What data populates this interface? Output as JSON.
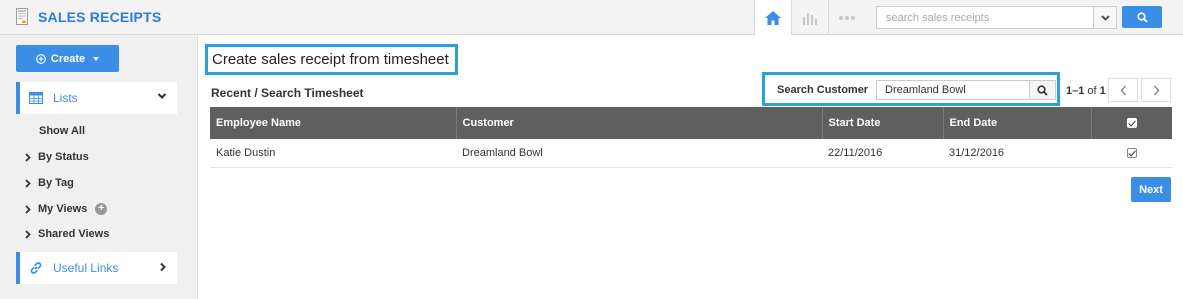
{
  "app": {
    "title": "SALES RECEIPTS",
    "icon": "document-icon"
  },
  "topbar": {
    "nav_icons": [
      "home-icon",
      "bar-chart-icon",
      "more-dots-icon"
    ],
    "search": {
      "placeholder": "search sales receipts",
      "value": ""
    },
    "accent": "#3a8ee6"
  },
  "sidebar": {
    "create_label": "Create",
    "lists_label": "Lists",
    "items": [
      {
        "label": "Show All",
        "chevron": false
      },
      {
        "label": "By Status",
        "chevron": true
      },
      {
        "label": "By Tag",
        "chevron": true
      },
      {
        "label": "My Views",
        "chevron": true,
        "add_icon": true
      },
      {
        "label": "Shared Views",
        "chevron": true
      }
    ],
    "useful_links_label": "Useful Links"
  },
  "main": {
    "page_title": "Create sales receipt from timesheet",
    "section_title": "Recent / Search Timesheet",
    "customer_search": {
      "label": "Search Customer",
      "value": "Dreamland Bowl"
    },
    "pager": {
      "range": "1–1",
      "of": "of",
      "total": "1"
    },
    "table": {
      "columns": [
        "Employee Name",
        "Customer",
        "Start Date",
        "End Date"
      ],
      "rows": [
        {
          "employee": "Katie Dustin",
          "customer": "Dreamland Bowl",
          "start": "22/11/2016",
          "end": "31/12/2016",
          "checked": true
        }
      ]
    },
    "next_label": "Next",
    "highlight_color": "#2aa0d8"
  }
}
